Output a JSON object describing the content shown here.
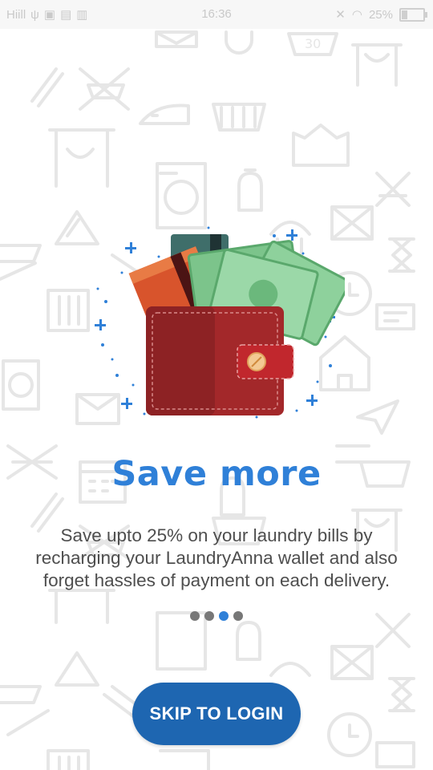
{
  "status_bar": {
    "left_text": "Hiill",
    "time": "16:36",
    "battery": "25%"
  },
  "onboarding": {
    "title": "Save more",
    "description": "Save upto 25% on your laundry bills by recharging your LaundryAnna wallet and also forget hassles of payment on each delivery.",
    "pager": {
      "total": 4,
      "active_index": 2
    },
    "skip_label": "SKIP TO LOGIN"
  },
  "colors": {
    "title": "#2f80d8",
    "button": "#1e66b1",
    "dot": "#777777",
    "dot_active": "#2f80d8",
    "wallet": "#a3282a"
  },
  "icons": [
    "wallet-icon",
    "cash-icon",
    "card-icon",
    "sparkle-icon"
  ]
}
